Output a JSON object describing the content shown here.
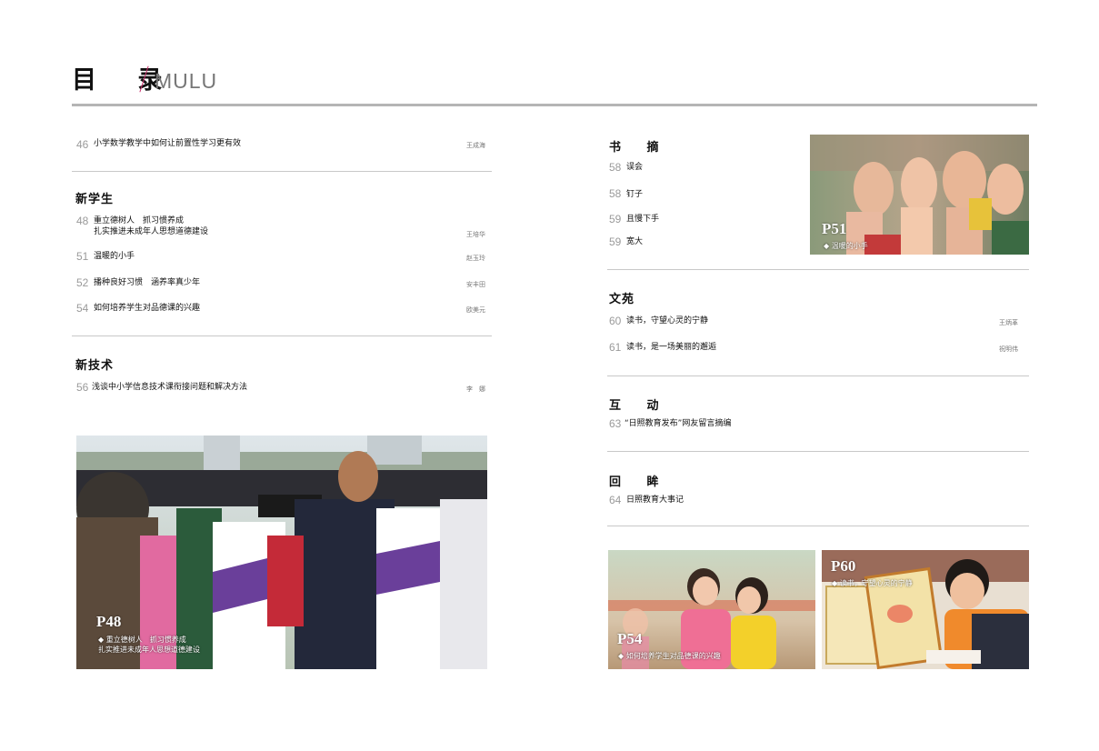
{
  "header": {
    "title": "目 录",
    "subtitle": "MULU"
  },
  "left": {
    "top_item": {
      "num": "46",
      "title": "小学数学教学中如何让前置性学习更有效",
      "author": "王成海"
    },
    "sec_new_student": {
      "heading": "新学生",
      "items": [
        {
          "num": "48",
          "title_line1": "重立德树人　抓习惯养成",
          "title_line2": "扎实推进未成年人思想道德建设",
          "author": "王培华"
        },
        {
          "num": "51",
          "title": "温暖的小手",
          "author": "赵玉玲"
        },
        {
          "num": "52",
          "title": "播种良好习惯　涵养率真少年",
          "author": "安丰田"
        },
        {
          "num": "54",
          "title": "如何培养学生对品德课的兴趣",
          "author": "欧美元"
        }
      ]
    },
    "sec_new_tech": {
      "heading": "新技术",
      "items": [
        {
          "num": "56",
          "title": "浅谈中小学信息技术课衔接问题和解决方法",
          "author": "李　娜"
        }
      ]
    },
    "photo_p48": {
      "page": "P48",
      "line1": "◆ 重立德树人　抓习惯养成",
      "line2": "扎实推进未成年人思想道德建设"
    }
  },
  "right": {
    "sec_digest": {
      "heading": "书 摘",
      "items": [
        {
          "num": "58",
          "title": "误会"
        },
        {
          "num": "58",
          "title": "钉子"
        },
        {
          "num": "59",
          "title": "且慢下手"
        },
        {
          "num": "59",
          "title": "宽大"
        }
      ]
    },
    "photo_p51": {
      "page": "P51",
      "line1": "◆ 温暖的小手"
    },
    "sec_garden": {
      "heading": "文苑",
      "items": [
        {
          "num": "60",
          "title": "读书，守望心灵的宁静",
          "author": "王炳革"
        },
        {
          "num": "61",
          "title": "读书，是一场美丽的邂逅",
          "author": "祝明伟"
        }
      ]
    },
    "sec_interact": {
      "heading": "互 动",
      "items": [
        {
          "num": "63",
          "title": "“日照教育发布”网友留言摘编"
        }
      ]
    },
    "sec_review": {
      "heading": "回 眸",
      "items": [
        {
          "num": "64",
          "title": "日照教育大事记"
        }
      ]
    },
    "photo_p54": {
      "page": "P54",
      "line1": "◆ 如何培养学生对品德课的兴趣"
    },
    "photo_p60": {
      "page": "P60",
      "line1": "◆ 读书，守望心灵的宁静"
    }
  }
}
